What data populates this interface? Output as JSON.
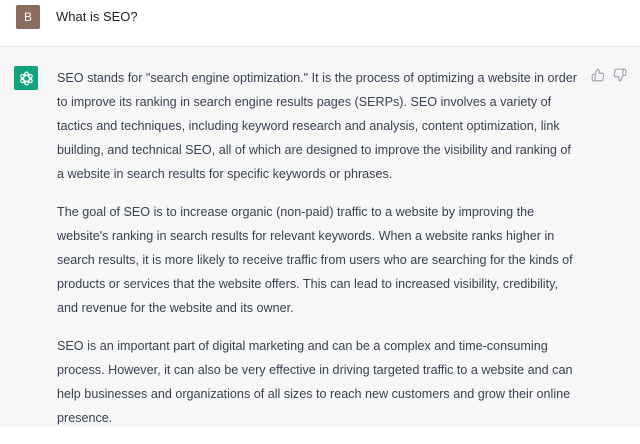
{
  "user_message": {
    "avatar_letter": "B",
    "text": "What is SEO?"
  },
  "assistant_message": {
    "paragraphs": [
      "SEO stands for \"search engine optimization.\" It is the process of optimizing a website in order to improve its ranking in search engine results pages (SERPs). SEO involves a variety of tactics and techniques, including keyword research and analysis, content optimization, link building, and technical SEO, all of which are designed to improve the visibility and ranking of a website in search results for specific keywords or phrases.",
      "The goal of SEO is to increase organic (non-paid) traffic to a website by improving the website's ranking in search results for relevant keywords. When a website ranks higher in search results, it is more likely to receive traffic from users who are searching for the kinds of products or services that the website offers. This can lead to increased visibility, credibility, and revenue for the website and its owner.",
      "SEO is an important part of digital marketing and can be a complex and time-consuming process. However, it can also be very effective in driving targeted traffic to a website and can help businesses and organizations of all sizes to reach new customers and grow their online presence."
    ]
  },
  "icons": {
    "assistant_avatar": "openai-logo-icon",
    "thumbs_up": "thumbs-up-icon",
    "thumbs_down": "thumbs-down-icon"
  },
  "colors": {
    "assistant_bg": "#f7f7f8",
    "assistant_avatar_bg": "#10a37f",
    "user_avatar_bg": "#8a6b5f"
  }
}
